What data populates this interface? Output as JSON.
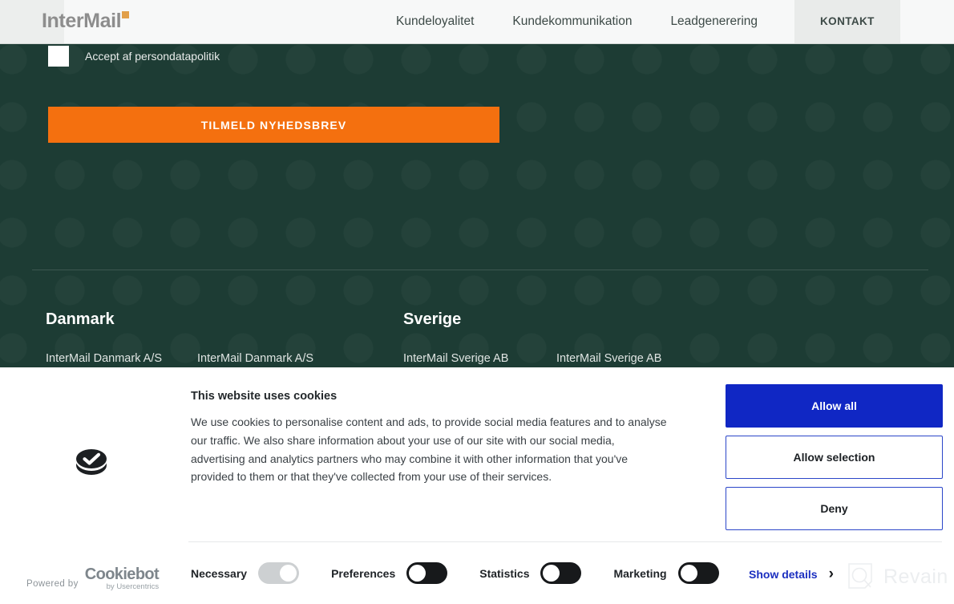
{
  "header": {
    "logo_text": "InterMail",
    "logo_mark": "orange-square-accent",
    "nav": [
      {
        "label": "Kundeloyalitet",
        "name": "nav-kundeloyalitet"
      },
      {
        "label": "Kundekommunikation",
        "name": "nav-kundekommunikation"
      },
      {
        "label": "Leadgenerering",
        "name": "nav-leadgenerering"
      },
      {
        "label": "KONTAKT",
        "name": "nav-kontakt"
      }
    ]
  },
  "newsletter": {
    "consent_label": "Accept af persondatapolitik",
    "consent_checked": false,
    "submit_label": "TILMELD NYHEDSBREV",
    "submit_color": "#f4700f"
  },
  "footer": {
    "background_color": "#1d3c34",
    "countries": [
      {
        "heading": "Danmark",
        "entries": [
          "InterMail Danmark A/S",
          "InterMail Danmark A/S"
        ]
      },
      {
        "heading": "Sverige",
        "entries": [
          "InterMail Sverige AB",
          "InterMail Sverige AB"
        ]
      }
    ]
  },
  "cookie_banner": {
    "icon": "cookie-check-icon",
    "title": "This website uses cookies",
    "description": "We use cookies to personalise content and ads, to provide social media features and to analyse our traffic. We also share information about your use of our site with our social media, advertising and analytics partners who may combine it with other information that you've provided to them or that they've collected from your use of their services.",
    "buttons": [
      {
        "label": "Allow all",
        "style": "primary",
        "name": "allow-all-button"
      },
      {
        "label": "Allow selection",
        "style": "secondary",
        "name": "allow-selection-button"
      },
      {
        "label": "Deny",
        "style": "secondary",
        "name": "deny-button"
      }
    ],
    "primary_color": "#1027c4",
    "branding": {
      "prefix": "Powered by",
      "name": "Cookiebot",
      "sub": "by Usercentrics"
    },
    "consent_categories": [
      {
        "label": "Necessary",
        "state": "on-disabled",
        "name": "toggle-necessary"
      },
      {
        "label": "Preferences",
        "state": "off",
        "name": "toggle-preferences"
      },
      {
        "label": "Statistics",
        "state": "off",
        "name": "toggle-statistics"
      },
      {
        "label": "Marketing",
        "state": "off",
        "name": "toggle-marketing"
      }
    ],
    "show_details_label": "Show details",
    "chevron": "›"
  },
  "watermark": {
    "text": "Revain"
  }
}
